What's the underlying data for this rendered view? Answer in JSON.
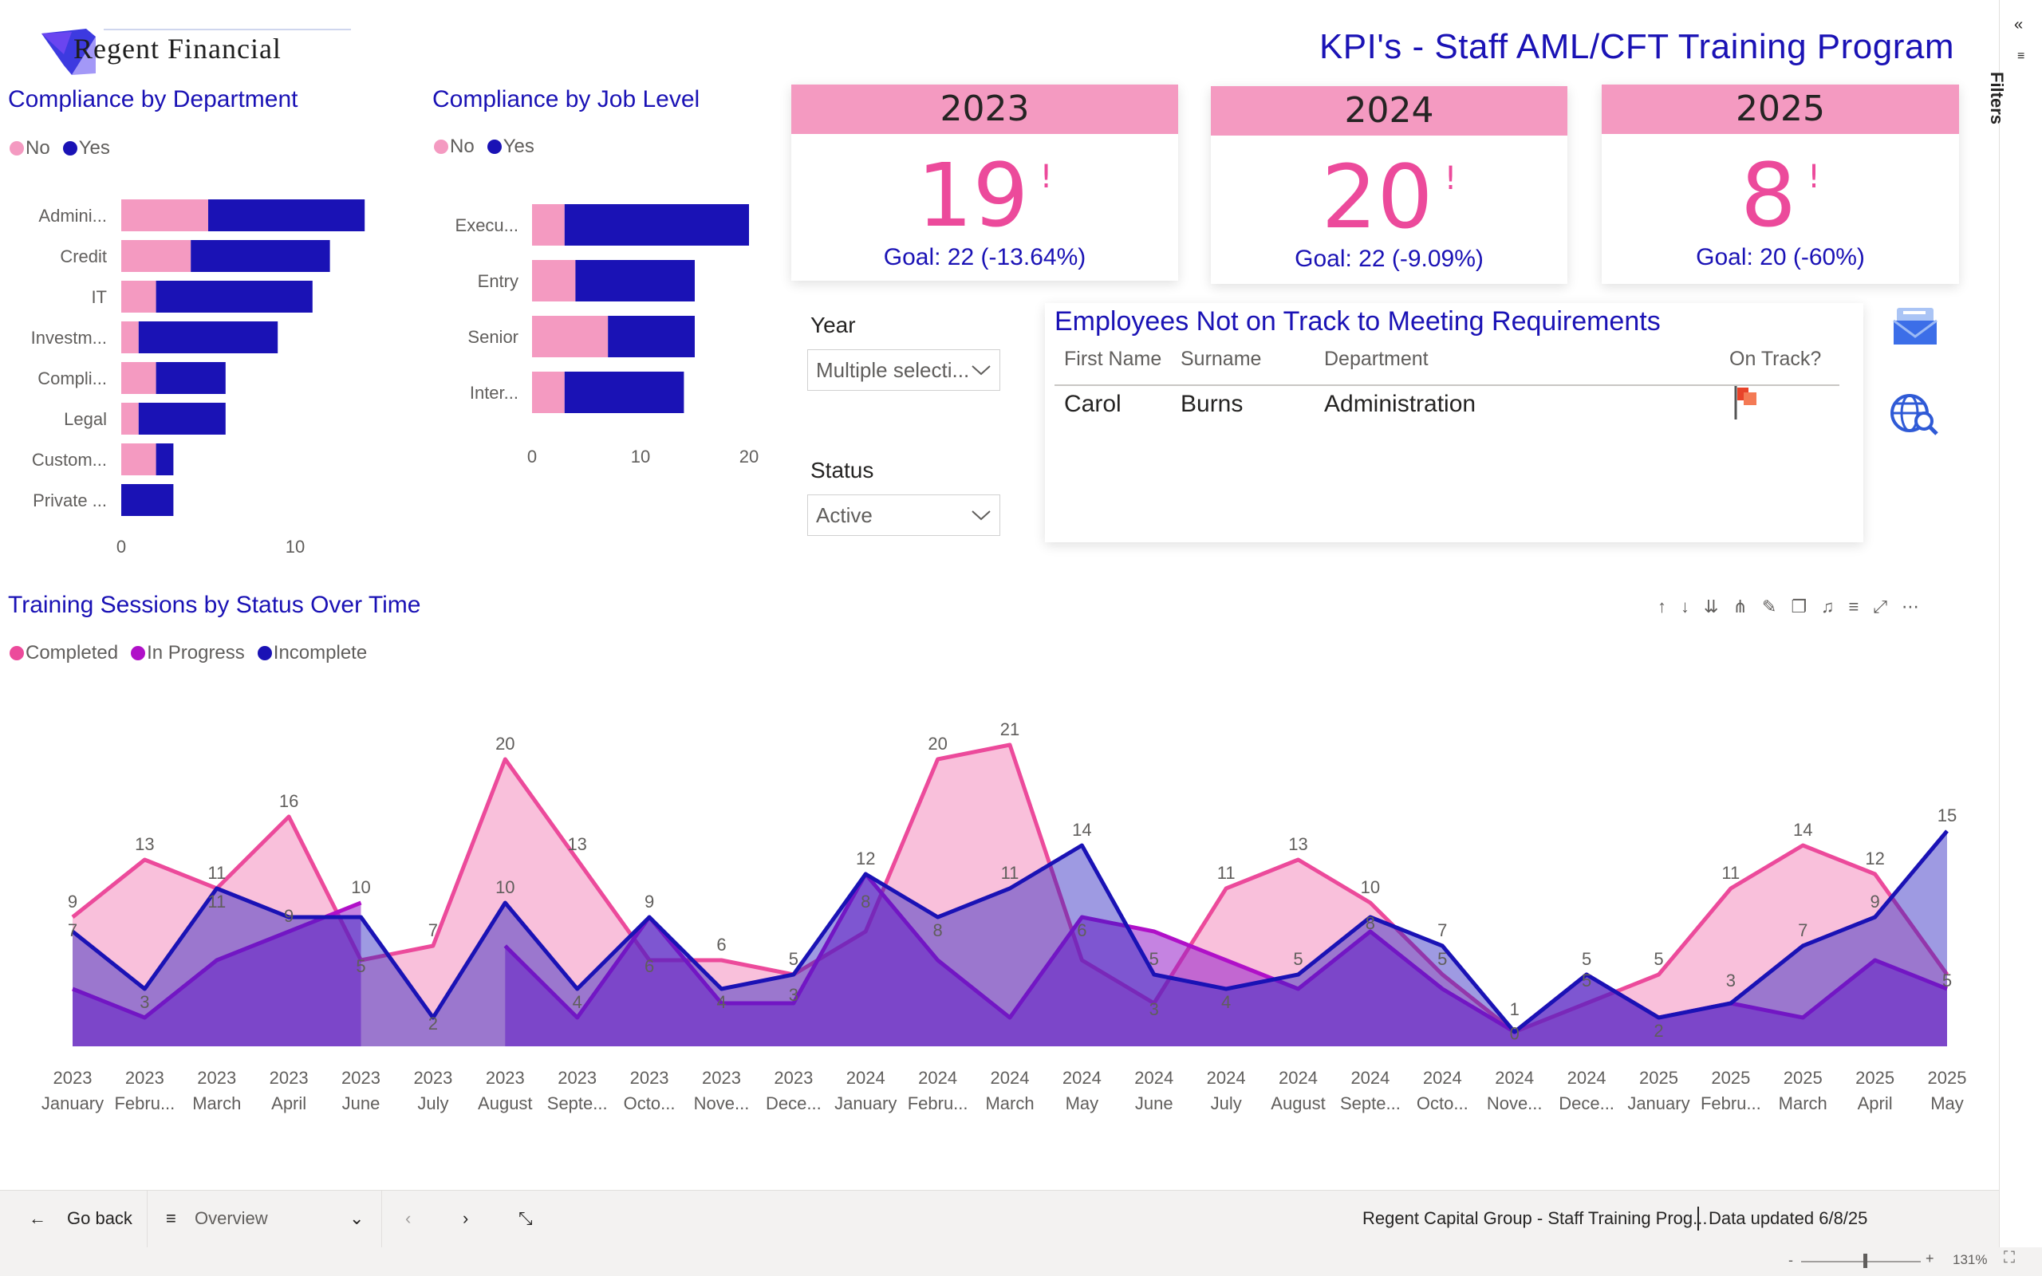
{
  "header": {
    "logo_text": "Regent Financial",
    "title": "KPI's - Staff AML/CFT Training Program"
  },
  "dept_chart": {
    "title": "Compliance by Department",
    "legend": [
      {
        "label": "No",
        "color": "#f49ac1"
      },
      {
        "label": "Yes",
        "color": "#1a12b5"
      }
    ],
    "ticks": [
      "0",
      "10"
    ]
  },
  "job_chart": {
    "title": "Compliance by Job Level",
    "legend": [
      {
        "label": "No",
        "color": "#f49ac1"
      },
      {
        "label": "Yes",
        "color": "#1a12b5"
      }
    ],
    "ticks": [
      "0",
      "10",
      "20"
    ]
  },
  "kpis": [
    {
      "year": "2023",
      "value": "19",
      "goal": "Goal: 22 (-13.64%)"
    },
    {
      "year": "2024",
      "value": "20",
      "goal": "Goal: 22 (-9.09%)"
    },
    {
      "year": "2025",
      "value": "8",
      "goal": "Goal: 20 (-60%)"
    }
  ],
  "kpi_alert_glyph": "!",
  "slicers": {
    "year_label": "Year",
    "year_value": "Multiple selecti...",
    "status_label": "Status",
    "status_value": "Active"
  },
  "employees": {
    "title": "Employees Not on Track to Meeting Requirements",
    "columns": [
      "First Name",
      "Surname",
      "Department",
      "On Track?"
    ],
    "rows": [
      {
        "first": "Carol",
        "surname": "Burns",
        "department": "Administration",
        "on_track_icon": "red-flag-icon"
      }
    ]
  },
  "sessions_chart": {
    "title": "Training Sessions by Status Over Time",
    "legend": [
      {
        "label": "Completed",
        "color": "#ec4a9b"
      },
      {
        "label": "In Progress",
        "color": "#b010c8"
      },
      {
        "label": "Incomplete",
        "color": "#1a12b5"
      }
    ]
  },
  "chart_data": [
    {
      "type": "bar",
      "title": "Compliance by Department",
      "orientation": "horizontal",
      "stacked": true,
      "categories": [
        "Admini...",
        "Credit",
        "IT",
        "Investm...",
        "Compli...",
        "Legal",
        "Custom...",
        "Private ..."
      ],
      "series": [
        {
          "name": "No",
          "values": [
            5,
            4,
            2,
            1,
            2,
            1,
            2,
            0
          ]
        },
        {
          "name": "Yes",
          "values": [
            9,
            8,
            9,
            8,
            4,
            5,
            1,
            3
          ]
        }
      ],
      "xlim": [
        0,
        15
      ]
    },
    {
      "type": "bar",
      "title": "Compliance by Job Level",
      "orientation": "horizontal",
      "stacked": true,
      "categories": [
        "Execu...",
        "Entry",
        "Senior",
        "Inter..."
      ],
      "series": [
        {
          "name": "No",
          "values": [
            3,
            4,
            7,
            3
          ]
        },
        {
          "name": "Yes",
          "values": [
            17,
            11,
            8,
            11
          ]
        }
      ],
      "xlim": [
        0,
        20
      ]
    },
    {
      "type": "area",
      "title": "Training Sessions by Status Over Time",
      "categories": [
        "2023 January",
        "2023 Febru...",
        "2023 March",
        "2023 April",
        "2023 June",
        "2023 July",
        "2023 August",
        "2023 Septe...",
        "2023 Octo...",
        "2023 Nove...",
        "2023 Dece...",
        "2024 January",
        "2024 Febru...",
        "2024 March",
        "2024 May",
        "2024 June",
        "2024 July",
        "2024 August",
        "2024 Septe...",
        "2024 Octo...",
        "2024 Nove...",
        "2024 Dece...",
        "2025 January",
        "2025 Febru...",
        "2025 March",
        "2025 April",
        "2025 May"
      ],
      "series": [
        {
          "name": "Completed",
          "values": [
            9,
            13,
            11,
            16,
            6,
            7,
            20,
            13,
            6,
            6,
            5,
            8,
            20,
            21,
            6,
            3,
            11,
            13,
            10,
            5,
            1,
            3,
            5,
            11,
            14,
            12,
            5
          ]
        },
        {
          "name": "In Progress",
          "values": [
            4,
            2,
            6,
            8,
            10,
            null,
            7,
            2,
            9,
            3,
            3,
            12,
            6,
            2,
            9,
            8,
            6,
            4,
            8,
            4,
            1,
            5,
            2,
            3,
            2,
            6,
            4
          ]
        },
        {
          "name": "Incomplete",
          "values": [
            8,
            4,
            11,
            9,
            9,
            2,
            10,
            4,
            9,
            4,
            5,
            12,
            9,
            11,
            14,
            5,
            4,
            5,
            9,
            7,
            1,
            5,
            2,
            3,
            7,
            9,
            15
          ]
        }
      ],
      "labels": [
        {
          "i": 0,
          "y": 9,
          "t": "9"
        },
        {
          "i": 0,
          "y": 7,
          "t": "7"
        },
        {
          "i": 1,
          "y": 13,
          "t": "13"
        },
        {
          "i": 1,
          "y": 2,
          "t": "3"
        },
        {
          "i": 2,
          "y": 11,
          "t": "11"
        },
        {
          "i": 2,
          "y": 9,
          "t": "11"
        },
        {
          "i": 3,
          "y": 16,
          "t": "16"
        },
        {
          "i": 3,
          "y": 8,
          "t": "9"
        },
        {
          "i": 4,
          "y": 10,
          "t": "10"
        },
        {
          "i": 4,
          "y": 4.5,
          "t": "5"
        },
        {
          "i": 5,
          "y": 7,
          "t": "7"
        },
        {
          "i": 5,
          "y": 0.5,
          "t": "2"
        },
        {
          "i": 6,
          "y": 20,
          "t": "20"
        },
        {
          "i": 6,
          "y": 10,
          "t": "10"
        },
        {
          "i": 7,
          "y": 13,
          "t": "13"
        },
        {
          "i": 7,
          "y": 2,
          "t": "4"
        },
        {
          "i": 8,
          "y": 9,
          "t": "9"
        },
        {
          "i": 8,
          "y": 4.5,
          "t": "6"
        },
        {
          "i": 9,
          "y": 6,
          "t": "6"
        },
        {
          "i": 9,
          "y": 2,
          "t": "4"
        },
        {
          "i": 10,
          "y": 5,
          "t": "5"
        },
        {
          "i": 10,
          "y": 2.5,
          "t": "3"
        },
        {
          "i": 11,
          "y": 12,
          "t": "12"
        },
        {
          "i": 11,
          "y": 9,
          "t": "8"
        },
        {
          "i": 12,
          "y": 20,
          "t": "20"
        },
        {
          "i": 12,
          "y": 7,
          "t": "8"
        },
        {
          "i": 13,
          "y": 21,
          "t": "21"
        },
        {
          "i": 13,
          "y": 11,
          "t": "11"
        },
        {
          "i": 14,
          "y": 14,
          "t": "14"
        },
        {
          "i": 14,
          "y": 7,
          "t": "6"
        },
        {
          "i": 15,
          "y": 5,
          "t": "5"
        },
        {
          "i": 15,
          "y": 1.5,
          "t": "3"
        },
        {
          "i": 16,
          "y": 11,
          "t": "11"
        },
        {
          "i": 16,
          "y": 2,
          "t": "4"
        },
        {
          "i": 17,
          "y": 13,
          "t": "13"
        },
        {
          "i": 17,
          "y": 5,
          "t": "5"
        },
        {
          "i": 18,
          "y": 10,
          "t": "10"
        },
        {
          "i": 18,
          "y": 7.5,
          "t": "8"
        },
        {
          "i": 19,
          "y": 7,
          "t": "7"
        },
        {
          "i": 19,
          "y": 5,
          "t": "5"
        },
        {
          "i": 20,
          "y": 1.5,
          "t": "1"
        },
        {
          "i": 20,
          "y": -0.2,
          "t": "0"
        },
        {
          "i": 21,
          "y": 5,
          "t": "5"
        },
        {
          "i": 21,
          "y": 3.5,
          "t": "5"
        },
        {
          "i": 22,
          "y": 5,
          "t": "5"
        },
        {
          "i": 22,
          "y": 0,
          "t": "2"
        },
        {
          "i": 23,
          "y": 11,
          "t": "11"
        },
        {
          "i": 23,
          "y": 3.5,
          "t": "3"
        },
        {
          "i": 24,
          "y": 14,
          "t": "14"
        },
        {
          "i": 24,
          "y": 7,
          "t": "7"
        },
        {
          "i": 25,
          "y": 12,
          "t": "12"
        },
        {
          "i": 25,
          "y": 9,
          "t": "9"
        },
        {
          "i": 26,
          "y": 15,
          "t": "15"
        },
        {
          "i": 26,
          "y": 3.5,
          "t": "5"
        }
      ],
      "ylim": [
        0,
        21
      ]
    }
  ],
  "bottom_bar": {
    "back_label": "Go back",
    "page_label": "Overview",
    "report_name": "Regent Capital Group - Staff Training Prog...",
    "updated": "Data updated 6/8/25",
    "zoom": "131%"
  },
  "filters_label": "Filters"
}
